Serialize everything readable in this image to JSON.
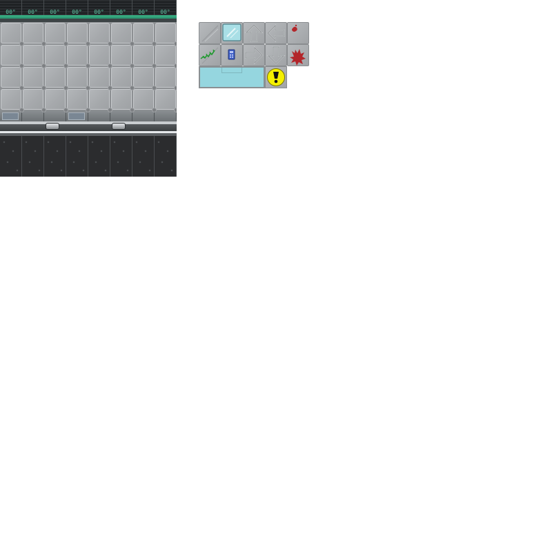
{
  "scene": {
    "top_strip_codes": [
      "00°",
      "00°",
      "00°",
      "00°",
      "00°",
      "00°",
      "00°",
      "00°"
    ],
    "floor_rows": 4,
    "floor_cols": 8
  },
  "palette": {
    "tiles": [
      {
        "name": "scratched-floor-tile",
        "icon": "scratch-icon"
      },
      {
        "name": "glass-floor-tile",
        "icon": "glass-panel-icon"
      },
      {
        "name": "arrow-up-tile",
        "icon": "arrow-up-icon"
      },
      {
        "name": "arrow-left-tile",
        "icon": "arrow-left-icon"
      },
      {
        "name": "blood-drop-tile",
        "icon": "blood-drop-icon"
      },
      {
        "name": "vine-floor-tile",
        "icon": "green-vine-icon"
      },
      {
        "name": "keypad-floor-tile",
        "icon": "keypad-icon"
      },
      {
        "name": "arrow-right-tile",
        "icon": "arrow-right-icon"
      },
      {
        "name": "arrow-down-tile",
        "icon": "arrow-down-icon"
      },
      {
        "name": "blood-splatter-tile",
        "icon": "blood-splatter-icon"
      }
    ],
    "wide_tile": {
      "name": "water-pool-tile",
      "color": "#95d6df"
    },
    "alert_tile": {
      "name": "alert-tile",
      "icon": "exclamation-warning-icon",
      "color": "#f5f000"
    }
  },
  "colors": {
    "accent_green": "#3bb789",
    "floor": "#aeb1b4",
    "space": "#2b2c2e",
    "blood": "#b3262a"
  }
}
